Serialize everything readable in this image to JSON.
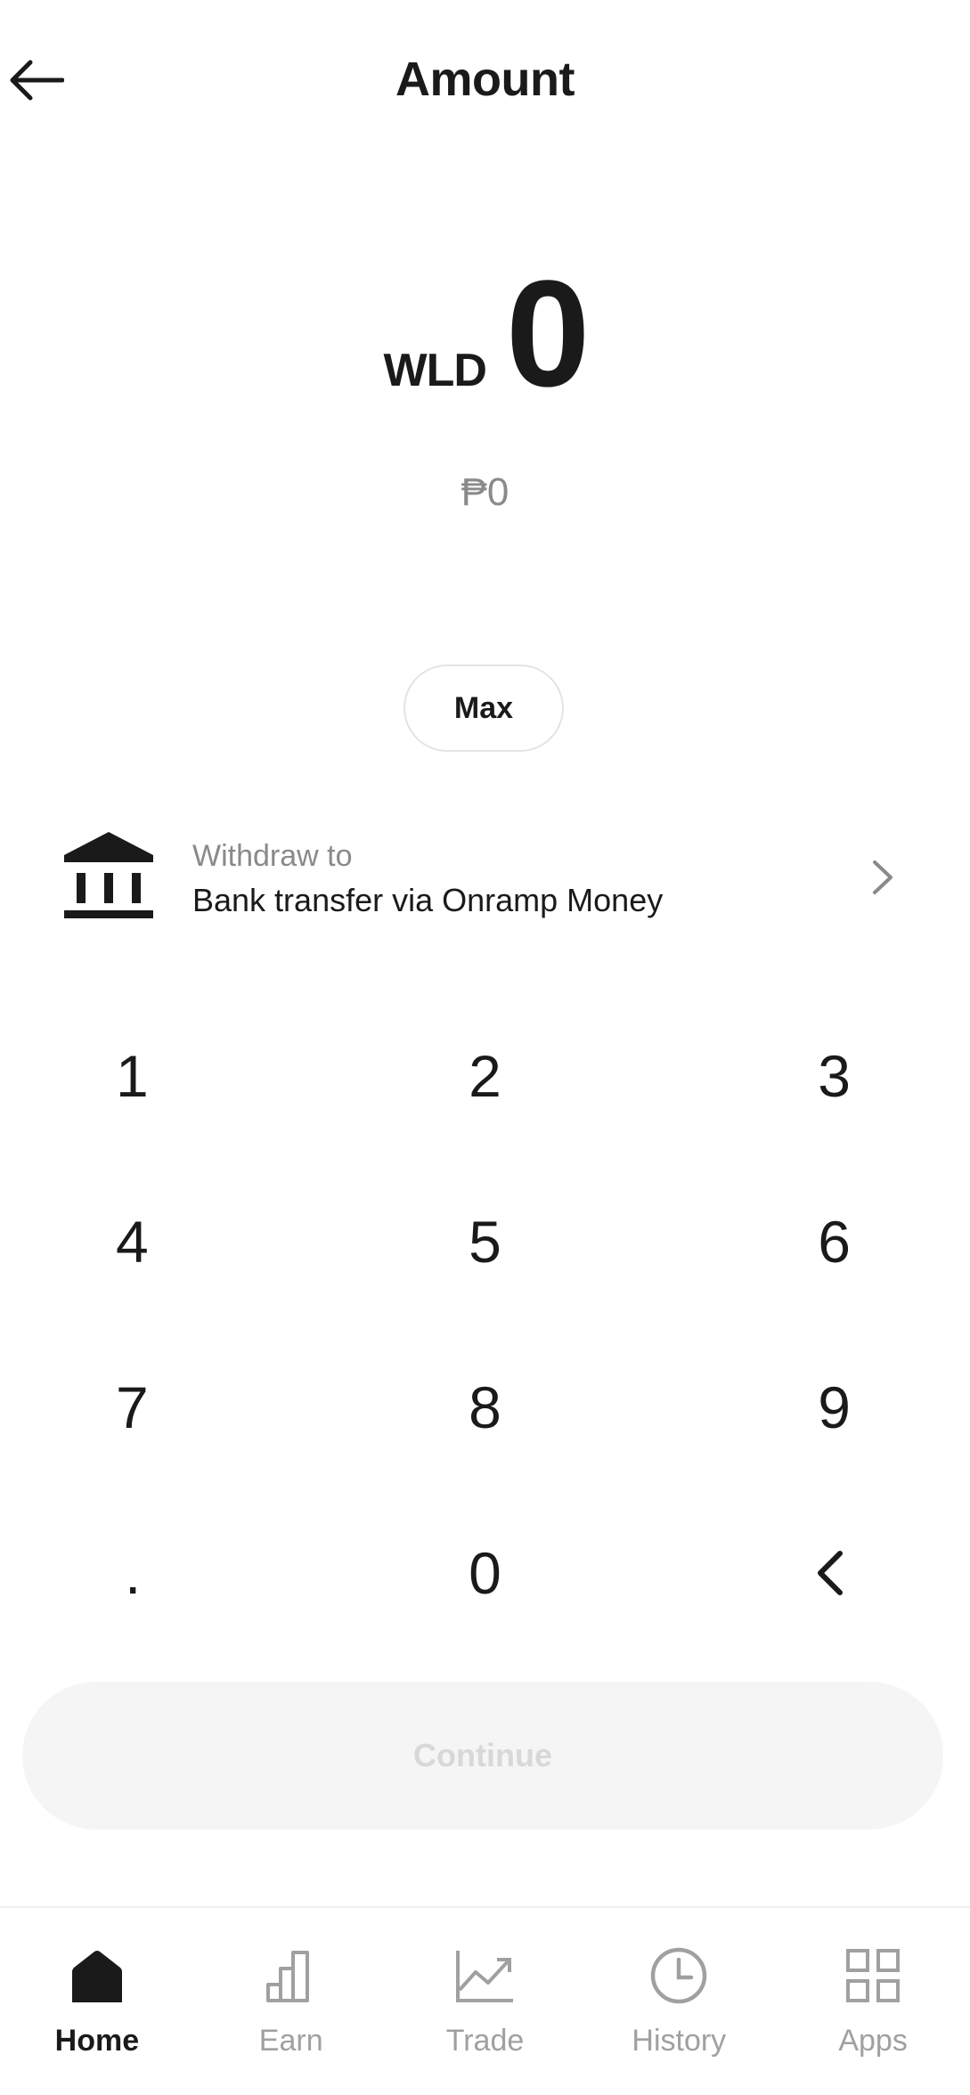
{
  "header": {
    "title": "Amount"
  },
  "amount": {
    "currency": "WLD",
    "value": "0",
    "fiat": "₱0"
  },
  "max_button": "Max",
  "withdraw": {
    "label": "Withdraw to",
    "method": "Bank transfer via Onramp Money"
  },
  "keypad": {
    "keys": [
      "1",
      "2",
      "3",
      "4",
      "5",
      "6",
      "7",
      "8",
      "9",
      ".",
      "0"
    ]
  },
  "continue_button": "Continue",
  "tabs": [
    {
      "label": "Home",
      "icon": "home-icon",
      "active": true
    },
    {
      "label": "Earn",
      "icon": "bar-chart-icon",
      "active": false
    },
    {
      "label": "Trade",
      "icon": "trend-chart-icon",
      "active": false
    },
    {
      "label": "History",
      "icon": "clock-icon",
      "active": false
    },
    {
      "label": "Apps",
      "icon": "apps-grid-icon",
      "active": false
    }
  ],
  "colors": {
    "text": "#1a1a1a",
    "muted": "#8a8a8a",
    "disabled_bg": "#f5f5f5",
    "disabled_text": "#d8d8d8"
  }
}
